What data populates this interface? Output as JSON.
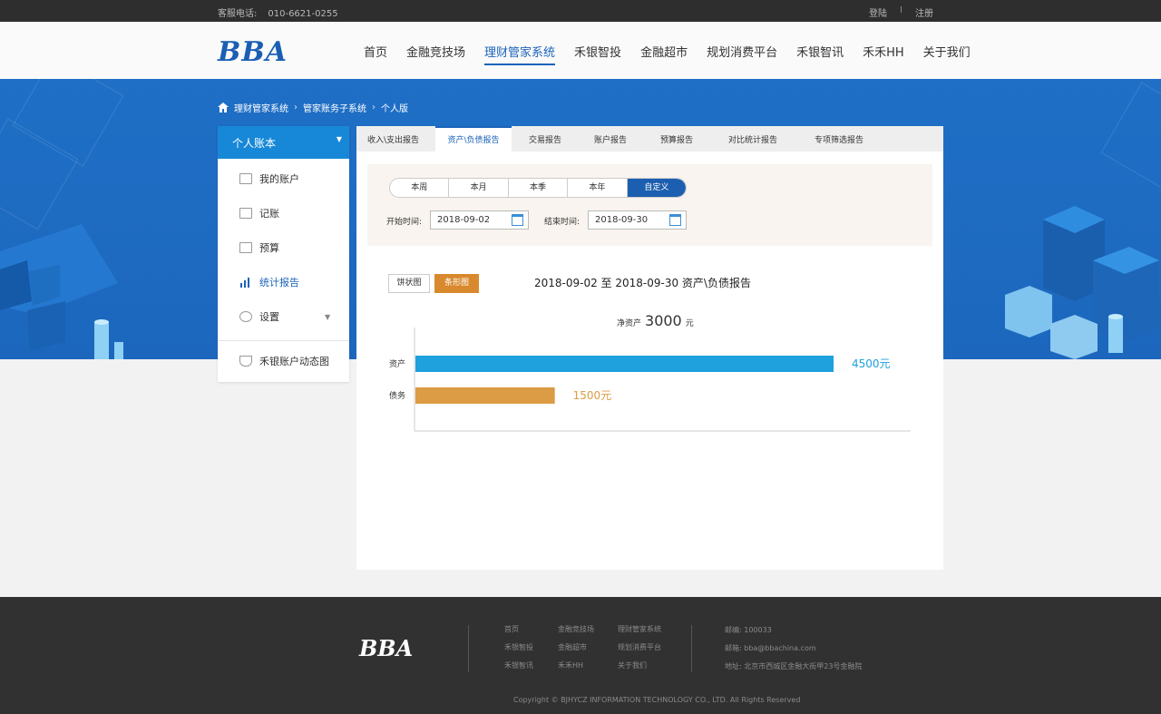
{
  "topbar": {
    "phone_label": "客服电话:",
    "phone": "010-6621-0255",
    "login": "登陆",
    "sep": "I",
    "register": "注册"
  },
  "header": {
    "logo": "BBA",
    "nav": [
      "首页",
      "金融竞技场",
      "理财管家系统",
      "禾银智投",
      "金融超市",
      "规划消费平台",
      "禾银智讯",
      "禾禾HH",
      "关于我们"
    ],
    "active_nav": "理财管家系统"
  },
  "breadcrumb": [
    "理财管家系统",
    "管家账务子系统",
    "个人版"
  ],
  "sidebar": {
    "title": "个人账本",
    "items": [
      {
        "label": "我的账户",
        "icon": "card-icon"
      },
      {
        "label": "记账",
        "icon": "edit-icon"
      },
      {
        "label": "预算",
        "icon": "calculator-icon"
      },
      {
        "label": "统计报告",
        "icon": "bar-chart-icon",
        "active": true
      },
      {
        "label": "设置",
        "icon": "gear-icon"
      }
    ],
    "extra": "禾银账户动态图"
  },
  "tabs": [
    "收入\\支出报告",
    "资产\\负债报告",
    "交易报告",
    "账户报告",
    "预算报告",
    "对比统计报告",
    "专项筛选报告"
  ],
  "active_tab": "资产\\负债报告",
  "filter": {
    "periods": [
      "本周",
      "本月",
      "本季",
      "本年",
      "自定义"
    ],
    "active_period": "自定义",
    "start_label": "开始时间:",
    "start_value": "2018-09-02",
    "end_label": "结束时间:",
    "end_value": "2018-09-30"
  },
  "view_toggle": {
    "pie": "饼状图",
    "bar": "条形图",
    "active": "条形图"
  },
  "report_title": "2018-09-02 至  2018-09-30  资产\\负债报告",
  "net": {
    "label": "净资产",
    "value": "3000",
    "unit": "元"
  },
  "chart_data": {
    "type": "bar",
    "orientation": "horizontal",
    "categories": [
      "资产",
      "债务"
    ],
    "values": [
      4500,
      1500
    ],
    "value_labels": [
      "4500元",
      "1500元"
    ],
    "colors": [
      "#1ea1dd",
      "#dc9b45"
    ],
    "xlim": [
      0,
      4500
    ],
    "grid": false
  },
  "footer": {
    "logo": "BBA",
    "links": [
      "首页",
      "金融竞技场",
      "理财管家系统",
      "禾银智投",
      "金融超市",
      "规划消费平台",
      "禾银智讯",
      "禾禾HH",
      "关于我们"
    ],
    "postcode": "邮编:  100033",
    "email": "邮箱:  bba@bbachina.com",
    "address": "地址:  北京市西城区金融大街甲23号金融院",
    "copyright": "Copyright © BJHYCZ INFORMATION TECHNOLOGY CO., LTD. All Rights Reserved"
  }
}
